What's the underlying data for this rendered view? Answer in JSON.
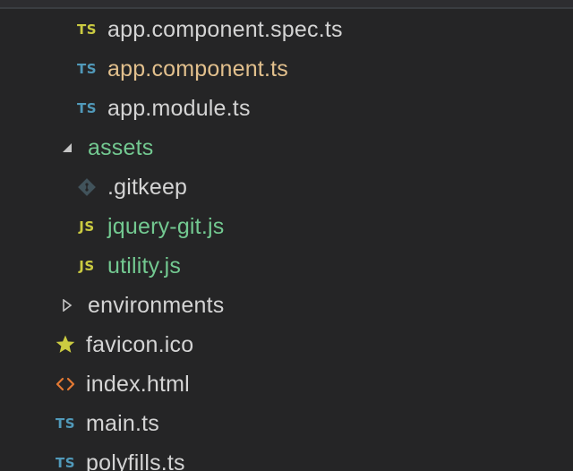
{
  "explorer": {
    "items": [
      {
        "label": "app.component.spec.ts",
        "badge": "TS",
        "badge_color": "#cbcb41",
        "text_color": "#d4d4d4"
      },
      {
        "label": "app.component.ts",
        "badge": "TS",
        "badge_color": "#519aba",
        "text_color": "#e2c08d"
      },
      {
        "label": "app.module.ts",
        "badge": "TS",
        "badge_color": "#519aba",
        "text_color": "#d4d4d4"
      },
      {
        "label": "assets",
        "text_color": "#73c991"
      },
      {
        "label": ".gitkeep",
        "text_color": "#d4d4d4"
      },
      {
        "label": "jquery-git.js",
        "badge": "JS",
        "badge_color": "#cbcb41",
        "text_color": "#73c991"
      },
      {
        "label": "utility.js",
        "badge": "JS",
        "badge_color": "#cbcb41",
        "text_color": "#73c991"
      },
      {
        "label": "environments",
        "text_color": "#d4d4d4"
      },
      {
        "label": "favicon.ico",
        "icon": "star-icon",
        "icon_color": "#cbcb41",
        "text_color": "#d4d4d4"
      },
      {
        "label": "index.html",
        "icon": "html-brackets-icon",
        "icon_color": "#e37933",
        "text_color": "#d4d4d4"
      },
      {
        "label": "main.ts",
        "badge": "TS",
        "badge_color": "#519aba",
        "text_color": "#d4d4d4"
      },
      {
        "label": "polyfills.ts",
        "badge": "TS",
        "badge_color": "#519aba",
        "text_color": "#d4d4d4"
      }
    ]
  }
}
